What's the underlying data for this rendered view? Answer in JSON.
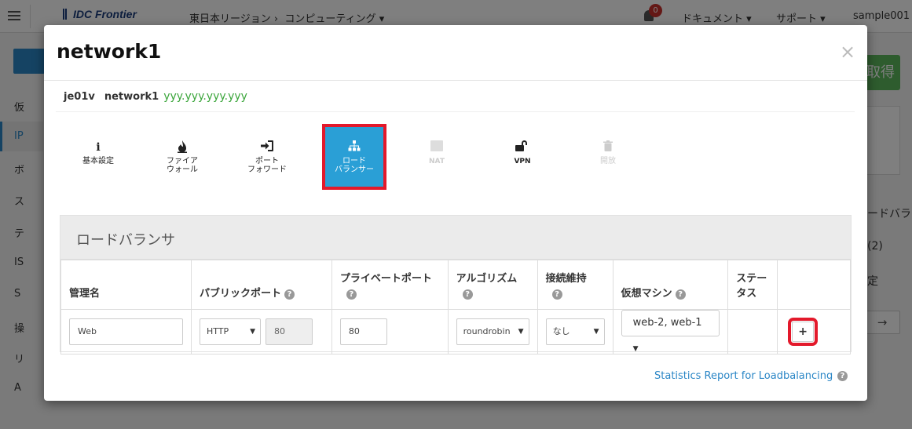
{
  "app": {
    "logo": "IDC Frontier",
    "region": "東日本リージョン ›",
    "service": "コンピューティング ▾",
    "notification_count": "0",
    "nav": [
      "ドキュメント ▾",
      "サポート ▾",
      "sample001 ▾"
    ],
    "sidebar": [
      "仮",
      "IP",
      "ボ",
      "ス",
      "テ",
      "IS",
      "S",
      "操",
      "リ",
      "A"
    ],
    "right_button": "取得",
    "right_texts": [
      "ードバラ",
      "(2)",
      "定"
    ],
    "right_arrow": "→"
  },
  "modal": {
    "title": "network1",
    "close": "×",
    "crumb_zone": "je01v",
    "crumb_network": "network1",
    "crumb_ip": "yyy.yyy.yyy.yyy",
    "tabs": [
      {
        "label1": "基本設定",
        "label2": "",
        "icon": "i"
      },
      {
        "label1": "ファイア",
        "label2": "ウォール",
        "icon": "🔥"
      },
      {
        "label1": "ポート",
        "label2": "フォワード",
        "icon": "⇥"
      },
      {
        "label1": "ロード",
        "label2": "バランサー",
        "icon": "品"
      },
      {
        "label1": "NAT",
        "label2": "",
        "icon": "▣"
      },
      {
        "label1": "VPN",
        "label2": "",
        "icon": "🔓"
      },
      {
        "label1": "開放",
        "label2": "",
        "icon": "🗑"
      }
    ],
    "panel_title": "ロードバランサ",
    "columns": [
      "管理名",
      "パブリックポート",
      "プライベートポート",
      "アルゴリズム",
      "接続維持",
      "仮想マシン",
      "ステー",
      "タス"
    ],
    "row": {
      "name": "Web",
      "protocol": "HTTP",
      "public_port": "80",
      "private_port": "80",
      "algorithm": "roundrobin",
      "persistence": "なし",
      "vms": "web-2, web-1",
      "add": "+"
    },
    "stats_link": "Statistics Report for Loadbalancing",
    "help": "?"
  }
}
